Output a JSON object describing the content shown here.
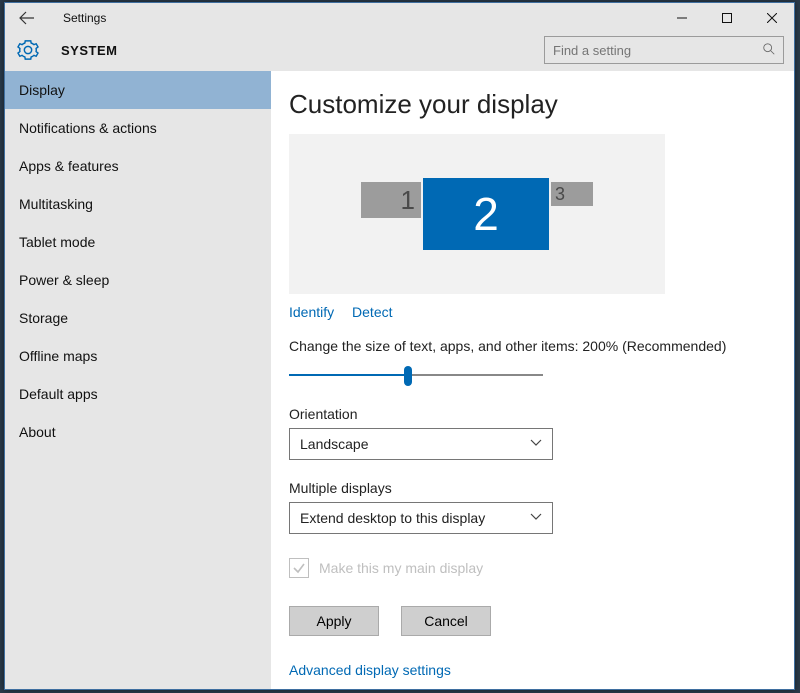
{
  "titlebar": {
    "title": "Settings"
  },
  "header": {
    "section": "SYSTEM",
    "search_placeholder": "Find a setting"
  },
  "sidebar": {
    "items": [
      {
        "label": "Display",
        "selected": true
      },
      {
        "label": "Notifications & actions",
        "selected": false
      },
      {
        "label": "Apps & features",
        "selected": false
      },
      {
        "label": "Multitasking",
        "selected": false
      },
      {
        "label": "Tablet mode",
        "selected": false
      },
      {
        "label": "Power & sleep",
        "selected": false
      },
      {
        "label": "Storage",
        "selected": false
      },
      {
        "label": "Offline maps",
        "selected": false
      },
      {
        "label": "Default apps",
        "selected": false
      },
      {
        "label": "About",
        "selected": false
      }
    ]
  },
  "main": {
    "heading": "Customize your display",
    "monitors": {
      "m1": "1",
      "m2": "2",
      "m3": "3",
      "selected": "2"
    },
    "identify_label": "Identify",
    "detect_label": "Detect",
    "scale_label": "Change the size of text, apps, and other items: 200% (Recommended)",
    "orientation_label": "Orientation",
    "orientation_value": "Landscape",
    "multiple_label": "Multiple displays",
    "multiple_value": "Extend desktop to this display",
    "main_display_label": "Make this my main display",
    "apply_label": "Apply",
    "cancel_label": "Cancel",
    "advanced_label": "Advanced display settings"
  }
}
